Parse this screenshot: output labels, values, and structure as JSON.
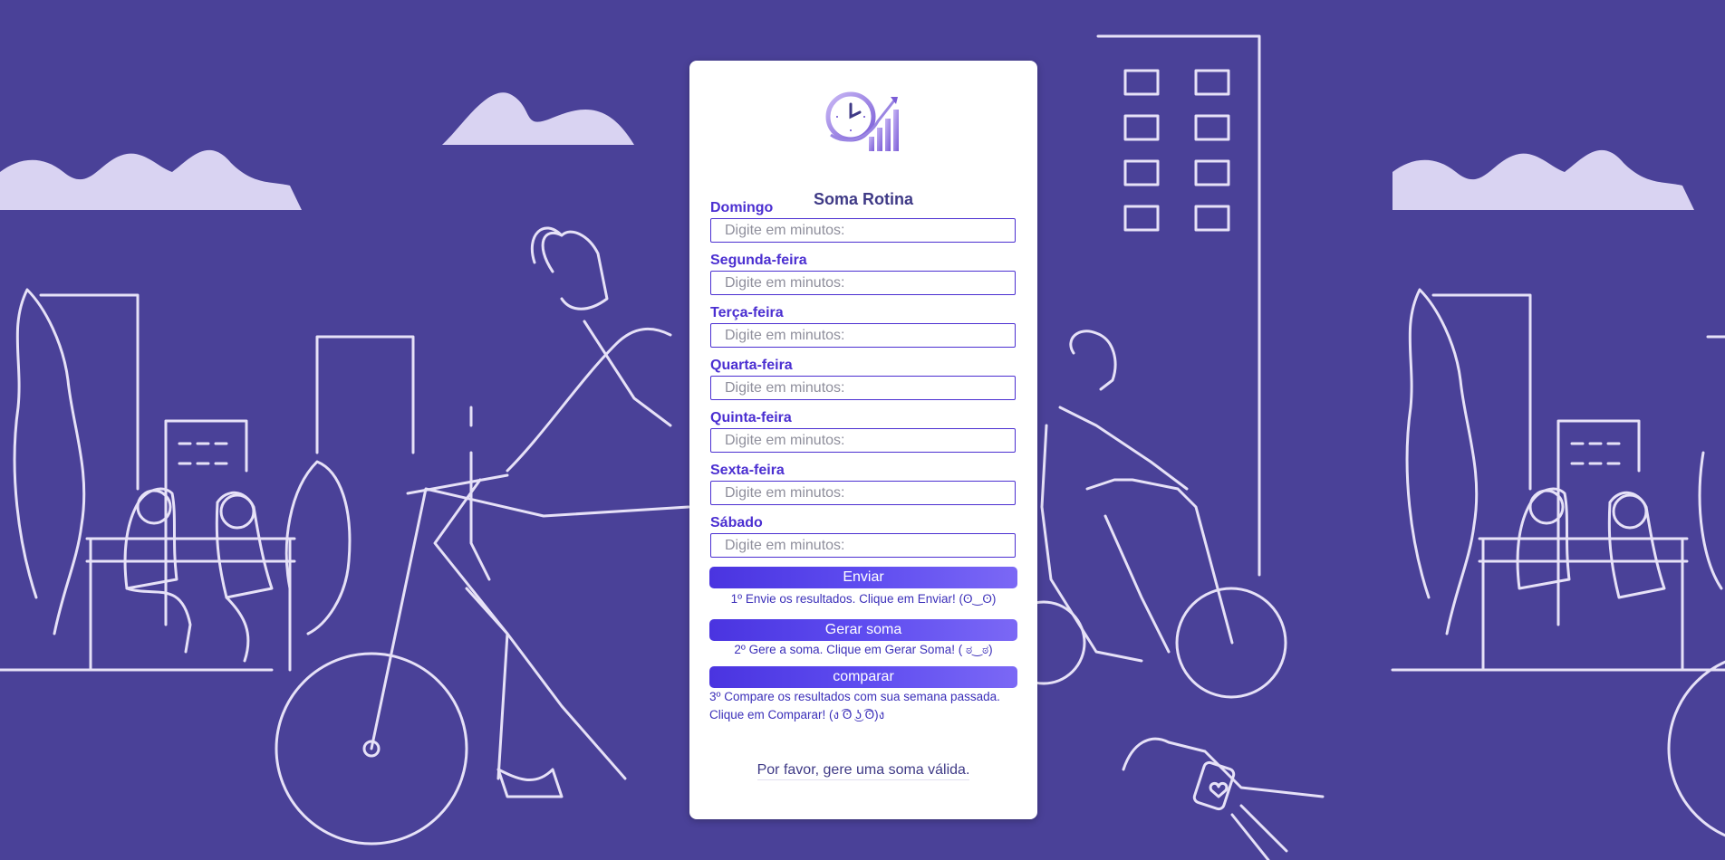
{
  "app": {
    "brand": "Soma Rotina"
  },
  "colors": {
    "background": "#4a4198",
    "accent": "#4b2fd1",
    "illustration": "#d9d3f2"
  },
  "form": {
    "fields": [
      {
        "label": "Domingo",
        "placeholder": "Digite em minutos:",
        "value": ""
      },
      {
        "label": "Segunda-feira",
        "placeholder": "Digite em minutos:",
        "value": ""
      },
      {
        "label": "Terça-feira",
        "placeholder": "Digite em minutos:",
        "value": ""
      },
      {
        "label": "Quarta-feira",
        "placeholder": "Digite em minutos:",
        "value": ""
      },
      {
        "label": "Quinta-feira",
        "placeholder": "Digite em minutos:",
        "value": ""
      },
      {
        "label": "Sexta-feira",
        "placeholder": "Digite em minutos:",
        "value": ""
      },
      {
        "label": "Sábado",
        "placeholder": "Digite em minutos:",
        "value": ""
      }
    ]
  },
  "actions": {
    "send_label": "Enviar",
    "send_hint": "1º Envie os resultados. Clique em Enviar! (ʘ‿ʘ)",
    "sum_label": "Gerar soma",
    "sum_hint": "2º Gere a soma. Clique em Gerar Soma! ( ಠ‿ಠ)",
    "compare_label": "comparar",
    "compare_hint_1": "3º Compare os resultados com sua semana passada.",
    "compare_hint_2": "Clique em Comparar! (ง ͡ʘ ͜ʖ ͡ʘ)ง"
  },
  "status": {
    "message": "Por favor, gere uma soma válida."
  },
  "icons": {
    "logo": "clock-growth-chart-icon"
  }
}
